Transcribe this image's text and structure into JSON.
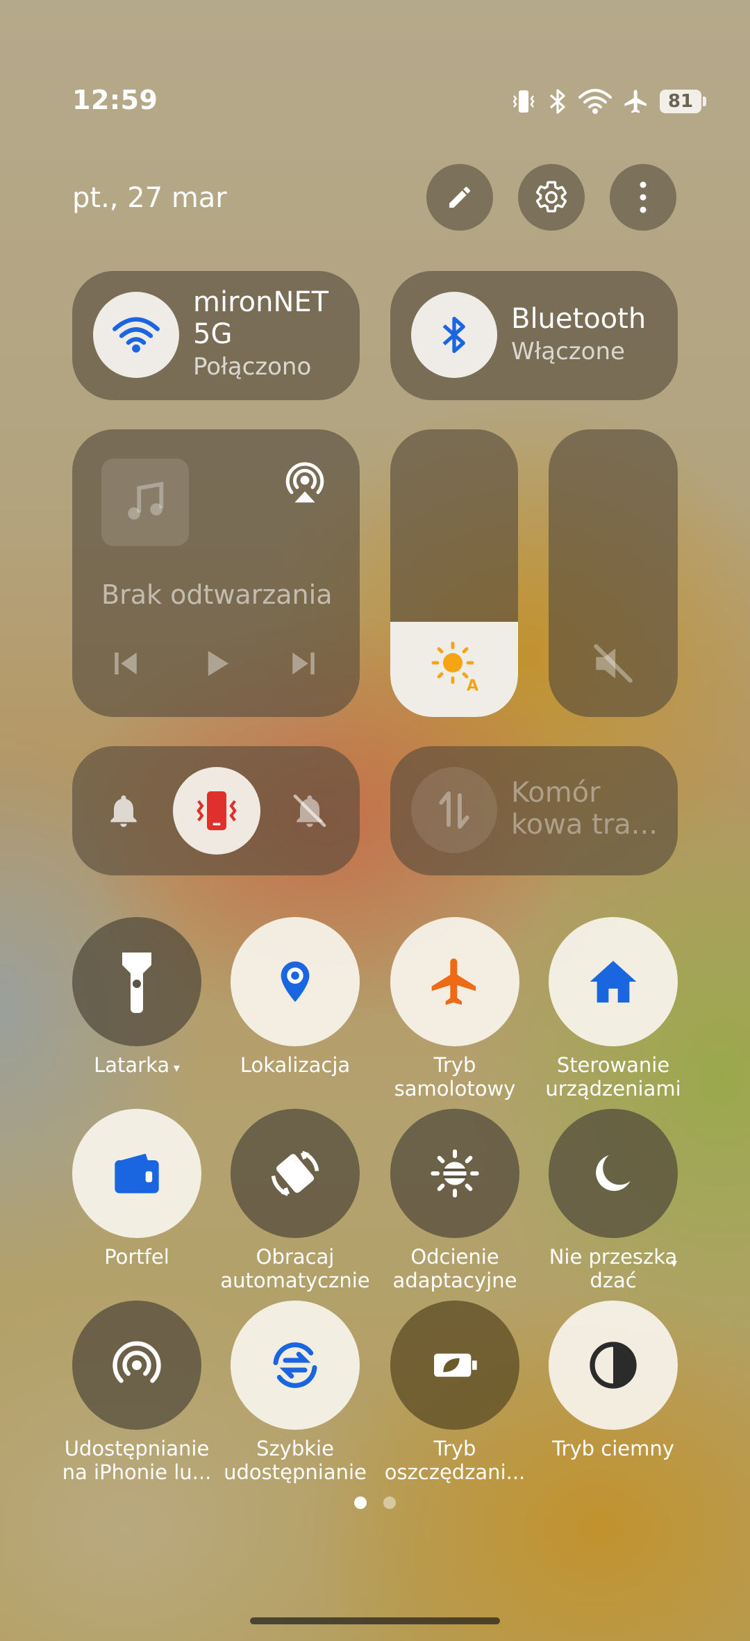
{
  "status_bar": {
    "time": "12:59",
    "battery_level": "81",
    "icons": [
      "vibrate-icon",
      "bluetooth-icon",
      "wifi-icon",
      "airplane-icon",
      "battery-icon"
    ]
  },
  "header": {
    "date": "pt., 27 mar",
    "buttons": [
      "edit-icon",
      "settings-icon",
      "more-icon"
    ]
  },
  "tiles": {
    "wifi": {
      "title_line1": "mironNET",
      "title_line2": "5G",
      "subtitle": "Połączono",
      "active": true
    },
    "bluetooth": {
      "title": "Bluetooth",
      "subtitle": "Włączone",
      "active": true
    },
    "media": {
      "label": "Brak odtwarzania"
    },
    "brightness": {
      "level": 0.33
    },
    "volume": {
      "muted": true
    },
    "sound_mode": {
      "options": [
        "ring",
        "vibrate",
        "silent"
      ],
      "selected": "vibrate"
    },
    "mobile_data": {
      "title_line1": "Komór",
      "title_line2": "kowa tra...",
      "active": false
    }
  },
  "toggles": [
    {
      "label": "Latarka",
      "icon": "flashlight-icon",
      "active": false,
      "has_menu": true
    },
    {
      "label": "Lokalizacja",
      "icon": "location-icon",
      "active": true
    },
    {
      "label_line1": "Tryb",
      "label_line2": "samolotowy",
      "icon": "airplane-icon",
      "active": true
    },
    {
      "label_line1": "Sterowanie",
      "label_line2": "urządzeniami",
      "icon": "home-icon",
      "active": true
    },
    {
      "label": "Portfel",
      "icon": "wallet-icon",
      "active": true
    },
    {
      "label_line1": "Obracaj",
      "label_line2": "automatycznie",
      "icon": "rotate-icon",
      "active": false
    },
    {
      "label_line1": "Odcienie",
      "label_line2": "adaptacyjne",
      "icon": "adaptive-tone-icon",
      "active": false
    },
    {
      "label_line1": "Nie przeszka",
      "label_line2": "dzać",
      "icon": "moon-icon",
      "active": false,
      "has_menu": true
    },
    {
      "label_line1": "Udostępnianie",
      "label_line2": "na iPhonie lu...",
      "icon": "share-icon",
      "active": false
    },
    {
      "label_line1": "Szybkie",
      "label_line2": "udostępnianie",
      "icon": "quick-share-icon",
      "active": true
    },
    {
      "label_line1": "Tryb",
      "label_line2": "oszczędzani...",
      "icon": "battery-saver-icon",
      "active": false
    },
    {
      "label": "Tryb ciemny",
      "icon": "dark-mode-icon",
      "active": true
    }
  ],
  "pager": {
    "pages": 2,
    "current": 1
  },
  "colors": {
    "accent_blue": "#1a66e0",
    "airplane_orange": "#ef6a16",
    "vibrate_red": "#e0302e",
    "sun_yellow": "#f5a514"
  }
}
